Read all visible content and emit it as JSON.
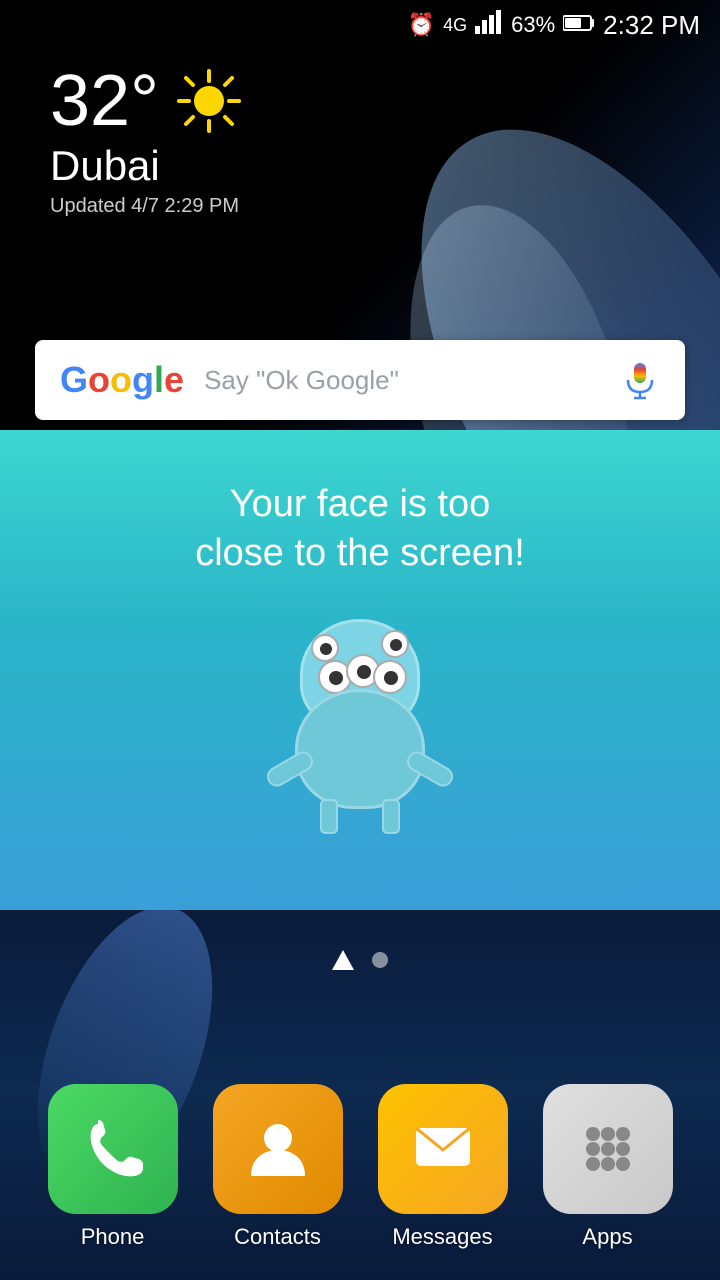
{
  "statusBar": {
    "time": "2:32 PM",
    "battery": "63%",
    "signal": "4G",
    "alarmIcon": "⏰"
  },
  "weather": {
    "temperature": "32°",
    "city": "Dubai",
    "updated": "Updated 4/7 2:29 PM",
    "condition": "sunny"
  },
  "googleBar": {
    "placeholder": "Say \"Ok Google\"",
    "logo": "Google"
  },
  "notification": {
    "message": "Your face is too\nclose to the screen!"
  },
  "pageIndicators": {
    "home": "home",
    "inactive": "inactive"
  },
  "dock": {
    "items": [
      {
        "id": "phone",
        "label": "Phone"
      },
      {
        "id": "contacts",
        "label": "Contacts"
      },
      {
        "id": "messages",
        "label": "Messages"
      },
      {
        "id": "apps",
        "label": "Apps"
      }
    ]
  }
}
